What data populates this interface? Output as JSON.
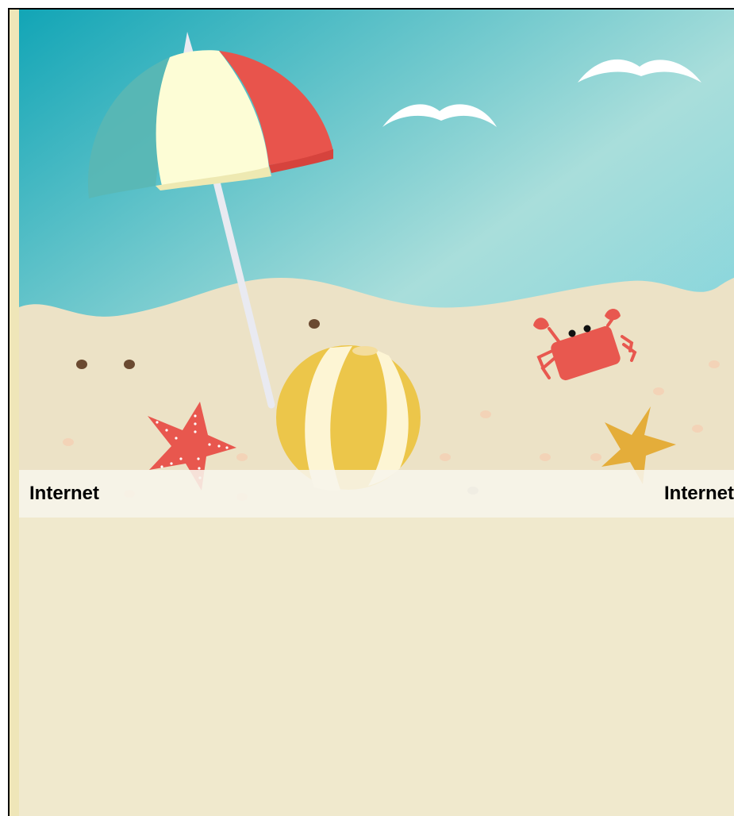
{
  "banner": {
    "label_left": "Internet",
    "label_right": "Internet"
  },
  "colors": {
    "sky_top": "#12a5b6",
    "sky_light": "#a9dedb",
    "sand": "#ece2c6",
    "page_bg": "#f0e9cd",
    "umbrella_red": "#e8544c",
    "umbrella_cream": "#fdfdd6",
    "umbrella_teal": "#5ab7b4",
    "ball_yellow": "#ecc64a",
    "crab_red": "#e8584f",
    "starfish_red": "#e8574e",
    "starfish_orange": "#e4ad3a"
  },
  "icons": [
    "umbrella-icon",
    "seagull-icon",
    "beach-ball-icon",
    "crab-icon",
    "starfish-icon"
  ]
}
